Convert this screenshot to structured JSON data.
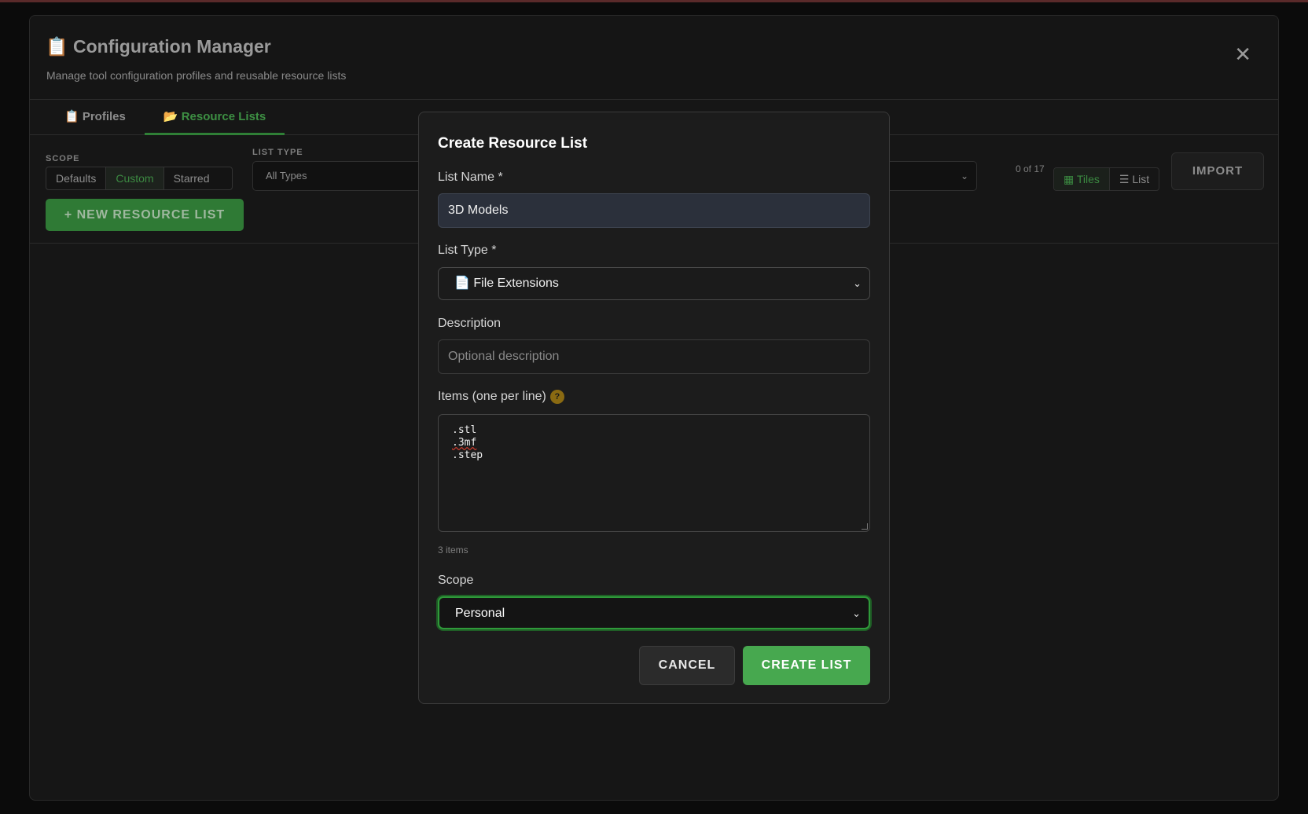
{
  "panel": {
    "title": "📋 Configuration Manager",
    "subtitle": "Manage tool configuration profiles and reusable resource lists",
    "close": "✕"
  },
  "tabs": [
    {
      "label": "📋 Profiles",
      "active": false
    },
    {
      "label": "📂 Resource Lists",
      "active": true
    }
  ],
  "toolbar": {
    "scope_label": "SCOPE",
    "scope_options": [
      "Defaults",
      "Custom",
      "Starred"
    ],
    "scope_selected": "Custom",
    "list_type_label": "LIST TYPE",
    "list_type_value": "All Types",
    "count": "0 of 17",
    "view_options": [
      "▦ Tiles",
      "☰ List"
    ],
    "view_selected": "▦ Tiles",
    "import_label": "IMPORT",
    "new_list_label": "+ NEW RESOURCE LIST"
  },
  "modal": {
    "title": "Create Resource List",
    "name_label": "List Name *",
    "name_value": "3D Models",
    "type_label": "List Type *",
    "type_value": "📄 File Extensions",
    "description_label": "Description",
    "description_placeholder": "Optional description",
    "items_label": "Items (one per line)",
    "help_icon": "?",
    "items": [
      ".stl",
      ".3mf",
      ".step"
    ],
    "items_count": "3 items",
    "scope_label": "Scope",
    "scope_value": "Personal",
    "cancel_label": "CANCEL",
    "create_label": "CREATE LIST"
  },
  "colors": {
    "accent_green": "#47a84f",
    "help_icon": "#8a6a12",
    "focus_ring": "#2f9a3a"
  }
}
